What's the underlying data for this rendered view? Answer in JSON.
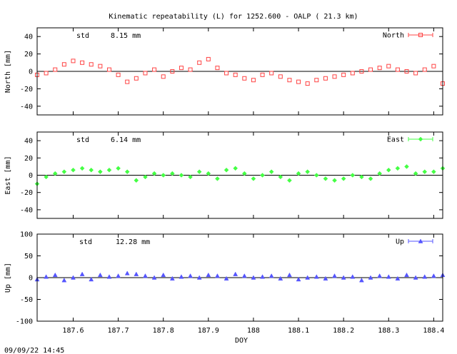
{
  "figure": {
    "title": "Kinematic repeatability (L) for 1252.600 - OALP  ( 21.3 km)",
    "xlabel": "DOY",
    "timestamp": "09/09/22 14:45"
  },
  "chart_data": [
    {
      "type": "scatter",
      "ylabel": "North [mm]",
      "legend": "North",
      "legend_position": "top-right",
      "std_label": "std",
      "std_value": "8.15 mm",
      "color": "#ff4444",
      "marker": "square",
      "xlim": [
        187.52,
        188.42
      ],
      "ylim": [
        -50,
        50
      ],
      "yticks": [
        -40,
        -20,
        0,
        20,
        40
      ],
      "xticks": [],
      "x": [
        187.52,
        187.54,
        187.56,
        187.58,
        187.6,
        187.62,
        187.64,
        187.66,
        187.68,
        187.7,
        187.72,
        187.74,
        187.76,
        187.78,
        187.8,
        187.82,
        187.84,
        187.86,
        187.88,
        187.9,
        187.92,
        187.94,
        187.96,
        187.98,
        188.0,
        188.02,
        188.04,
        188.06,
        188.08,
        188.1,
        188.12,
        188.14,
        188.16,
        188.18,
        188.2,
        188.22,
        188.24,
        188.26,
        188.28,
        188.3,
        188.32,
        188.34,
        188.36,
        188.38,
        188.4,
        188.42
      ],
      "y": [
        -4,
        -2,
        2,
        8,
        12,
        10,
        8,
        6,
        2,
        -4,
        -12,
        -8,
        -2,
        2,
        -6,
        0,
        4,
        2,
        10,
        14,
        4,
        -2,
        -4,
        -8,
        -10,
        -4,
        -2,
        -6,
        -10,
        -12,
        -14,
        -10,
        -8,
        -6,
        -4,
        -2,
        0,
        2,
        4,
        6,
        2,
        0,
        -2,
        2,
        6,
        -14
      ]
    },
    {
      "type": "scatter",
      "ylabel": "East [mm]",
      "legend": "East",
      "legend_position": "top-right",
      "std_label": "std",
      "std_value": "6.14 mm",
      "color": "#44ff44",
      "marker": "diamond",
      "xlim": [
        187.52,
        188.42
      ],
      "ylim": [
        -50,
        50
      ],
      "yticks": [
        -40,
        -20,
        0,
        20,
        40
      ],
      "xticks": [],
      "x": [
        187.52,
        187.54,
        187.56,
        187.58,
        187.6,
        187.62,
        187.64,
        187.66,
        187.68,
        187.7,
        187.72,
        187.74,
        187.76,
        187.78,
        187.8,
        187.82,
        187.84,
        187.86,
        187.88,
        187.9,
        187.92,
        187.94,
        187.96,
        187.98,
        188.0,
        188.02,
        188.04,
        188.06,
        188.08,
        188.1,
        188.12,
        188.14,
        188.16,
        188.18,
        188.2,
        188.22,
        188.24,
        188.26,
        188.28,
        188.3,
        188.32,
        188.34,
        188.36,
        188.38,
        188.4,
        188.42
      ],
      "y": [
        -10,
        -2,
        2,
        4,
        6,
        8,
        6,
        4,
        6,
        8,
        4,
        -6,
        -2,
        2,
        0,
        2,
        0,
        -2,
        4,
        2,
        -4,
        6,
        8,
        2,
        -4,
        0,
        4,
        -2,
        -6,
        2,
        4,
        0,
        -4,
        -6,
        -4,
        0,
        -2,
        -4,
        2,
        6,
        8,
        10,
        2,
        4,
        4,
        8
      ]
    },
    {
      "type": "scatter",
      "ylabel": "Up [mm]",
      "legend": "Up",
      "legend_position": "top-right",
      "std_label": "std",
      "std_value": "12.28 mm",
      "color": "#5555ff",
      "marker": "triangle",
      "xlim": [
        187.52,
        188.42
      ],
      "ylim": [
        -100,
        100
      ],
      "yticks": [
        -100,
        -50,
        0,
        50,
        100
      ],
      "xticks": [
        187.6,
        187.7,
        187.8,
        187.9,
        188,
        188.1,
        188.2,
        188.3,
        188.4
      ],
      "xtick_labels": [
        "187.6",
        "187.7",
        "187.8",
        "187.9",
        "188",
        "188.1",
        "188.2",
        "188.3",
        "188.4"
      ],
      "x": [
        187.52,
        187.54,
        187.56,
        187.58,
        187.6,
        187.62,
        187.64,
        187.66,
        187.68,
        187.7,
        187.72,
        187.74,
        187.76,
        187.78,
        187.8,
        187.82,
        187.84,
        187.86,
        187.88,
        187.9,
        187.92,
        187.94,
        187.96,
        187.98,
        188.0,
        188.02,
        188.04,
        188.06,
        188.08,
        188.1,
        188.12,
        188.14,
        188.16,
        188.18,
        188.2,
        188.22,
        188.24,
        188.26,
        188.28,
        188.3,
        188.32,
        188.34,
        188.36,
        188.38,
        188.4,
        188.42
      ],
      "y": [
        -4,
        2,
        6,
        -6,
        0,
        8,
        -4,
        6,
        2,
        4,
        10,
        8,
        4,
        0,
        6,
        -2,
        2,
        4,
        0,
        6,
        4,
        -2,
        8,
        4,
        0,
        2,
        4,
        -2,
        6,
        -4,
        0,
        2,
        -2,
        4,
        0,
        2,
        -6,
        0,
        4,
        2,
        -2,
        6,
        0,
        2,
        4,
        6
      ]
    }
  ]
}
